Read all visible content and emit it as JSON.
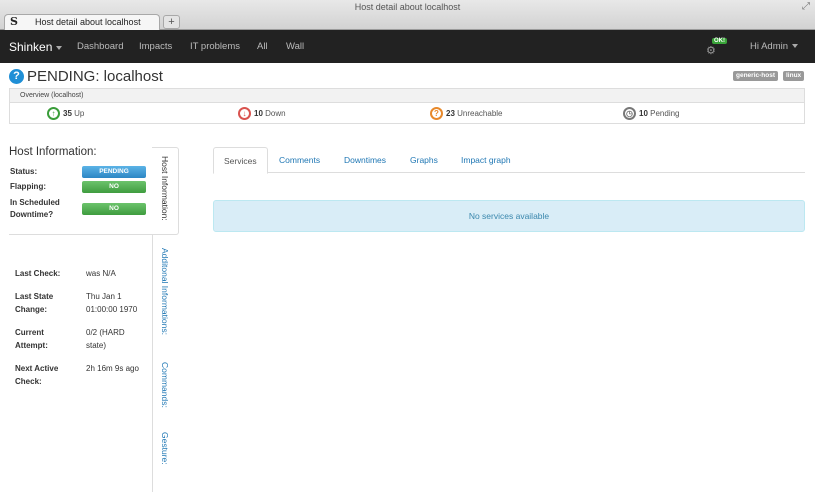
{
  "window": {
    "title": "Host detail about localhost"
  },
  "browser_tab": {
    "label": "Host detail about localhost",
    "favicon": "S",
    "new_tab": "+"
  },
  "navbar": {
    "brand": "Shinken",
    "items": [
      "Dashboard",
      "Impacts",
      "IT problems",
      "All",
      "Wall"
    ],
    "notification_badge": "OK!",
    "user": "Hi Admin"
  },
  "header": {
    "help_icon": "?",
    "title": "PENDING: localhost",
    "tags": [
      "generic-host",
      "linux"
    ]
  },
  "overview": {
    "heading": "Overview (localhost)",
    "items": [
      {
        "icon": "arrow-up-icon",
        "glyph": "↑",
        "count": "35",
        "label": "Up",
        "color": "#3a9d3a"
      },
      {
        "icon": "arrow-down-icon",
        "glyph": "↓",
        "count": "10",
        "label": "Down",
        "color": "#d9534f"
      },
      {
        "icon": "question-icon",
        "glyph": "?",
        "count": "23",
        "label": "Unreachable",
        "color": "#e8892b"
      },
      {
        "icon": "clock-icon",
        "glyph": "◷",
        "count": "10",
        "label": "Pending",
        "color": "#777777"
      }
    ]
  },
  "host_info": {
    "title": "Host Information:",
    "status_label": "Status:",
    "status_value": "PENDING",
    "flapping_label": "Flapping:",
    "flapping_value": "NO",
    "downtime_label_1": "In Scheduled",
    "downtime_label_2": "Downtime?",
    "downtime_value": "NO"
  },
  "details": {
    "last_check_label": "Last Check:",
    "last_check_value": "was N/A",
    "last_state_change_label_1": "Last State",
    "last_state_change_label_2": "Change:",
    "last_state_change_value_1": "Thu Jan 1",
    "last_state_change_value_2": "01:00:00 1970",
    "current_attempt_label_1": "Current",
    "current_attempt_label_2": "Attempt:",
    "current_attempt_value_1": "0/2 (HARD",
    "current_attempt_value_2": "state)",
    "next_check_label_1": "Next Active",
    "next_check_label_2": "Check:",
    "next_check_value": "2h 16m 9s ago"
  },
  "vertical_tabs": [
    "Host Information:",
    "Additonal Informations:",
    "Commands:",
    "Gesture:"
  ],
  "content_tabs": [
    "Services",
    "Comments",
    "Downtimes",
    "Graphs",
    "Impact graph"
  ],
  "services_message": "No services available",
  "colors": {
    "navbar": "#222222",
    "accent": "#1f77b4",
    "pending": "#2c86c4",
    "ok": "#3f9c3f",
    "alert_bg": "#d9edf7"
  }
}
